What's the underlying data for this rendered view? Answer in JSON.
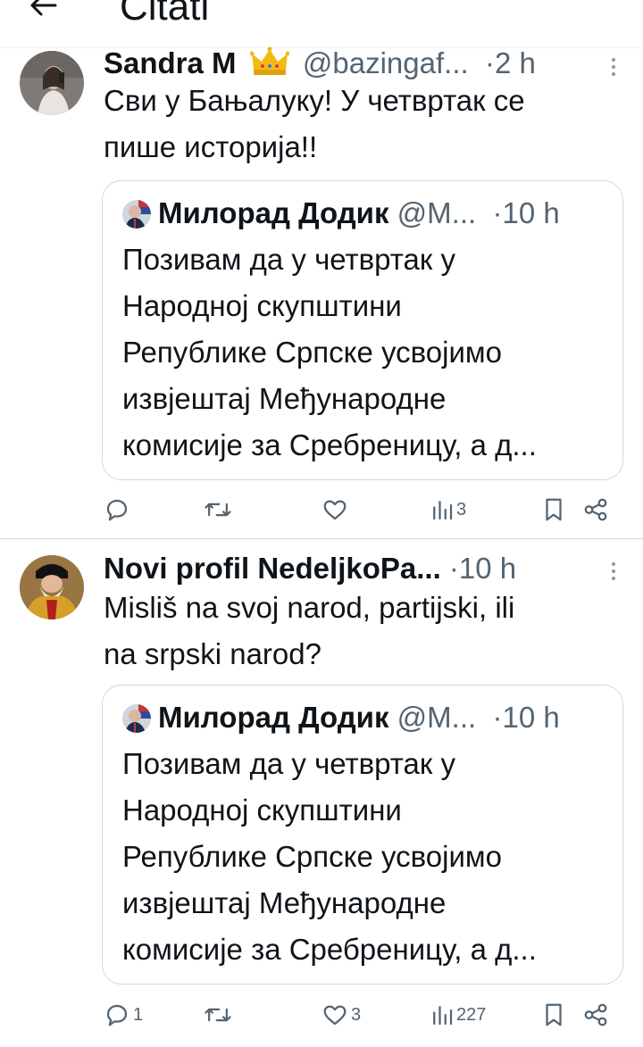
{
  "header": {
    "title": "Citati"
  },
  "tweets": [
    {
      "user": {
        "name": "Sandra M",
        "handle": "@bazingaf...",
        "badge_icon": "crown-icon"
      },
      "time": "2 h",
      "text_lines": [
        "Сви у Бањалуку! У четвртак се",
        "пише историја!!"
      ],
      "quote": {
        "name": "Милорад Додик",
        "handle": "@М...",
        "time": "10 h",
        "lines": [
          "Позивам да у четвртак у",
          "Народној скупштини",
          "Републике Српске усвојимо",
          "извјештај Међународне",
          "комисије за Сребреницу, а д..."
        ]
      },
      "actions": {
        "replies": "",
        "retweets": "",
        "likes": "",
        "views": "3"
      }
    },
    {
      "user": {
        "name": "Novi profil NedeljkoPa...",
        "handle": "",
        "badge_icon": ""
      },
      "time": "10 h",
      "text_lines": [
        "Misliš na svoj narod, partijski, ili",
        "na srpski narod?"
      ],
      "quote": {
        "name": "Милорад Додик",
        "handle": "@М...",
        "time": "10 h",
        "lines": [
          "Позивам да у четвртак у",
          "Народној скупштини",
          "Републике Српске усвојимо",
          "извјештај Међународне",
          "комисије за Сребреницу, а д..."
        ]
      },
      "actions": {
        "replies": "1",
        "retweets": "",
        "likes": "3",
        "views": "227"
      }
    }
  ],
  "colors": {
    "secondary_text": "#536471",
    "border": "#cfd9de",
    "crown": "#f5b914"
  }
}
